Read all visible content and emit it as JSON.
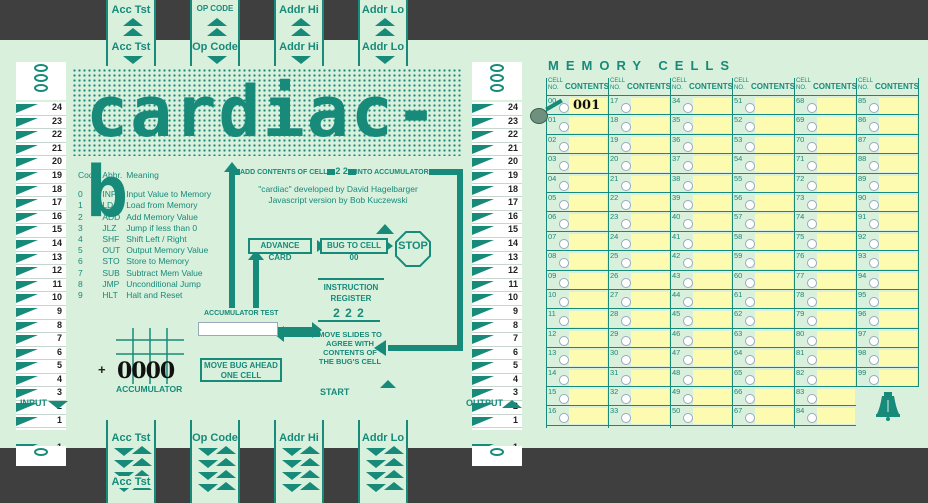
{
  "top_slides": [
    {
      "tab": "Acc Tst",
      "label": "Acc Tst"
    },
    {
      "tab": "OP CODE",
      "label": "Op Code"
    },
    {
      "tab": "Addr Hi",
      "label": "Addr Hi"
    },
    {
      "tab": "Addr Lo",
      "label": "Addr Lo"
    }
  ],
  "bottom_slides": [
    {
      "label": "Acc Tst",
      "tab": "Acc Tst"
    },
    {
      "label": "Op Code"
    },
    {
      "label": "Addr Hi"
    },
    {
      "label": "Addr Lo"
    }
  ],
  "title": "cardiac-b",
  "credits": [
    "\"cardiac\" developed by David Hagelbarger",
    "Javascript version by Bob Kuczewski"
  ],
  "codes": {
    "header": [
      "Code",
      "Abbr.",
      "Meaning"
    ],
    "rows": [
      [
        "0",
        "INP",
        "Input Value to Memory"
      ],
      [
        "1",
        "LD",
        "Load from Memory"
      ],
      [
        "2",
        "ADD",
        "Add Memory Value"
      ],
      [
        "3",
        "JLZ",
        "Jump if less than 0"
      ],
      [
        "4",
        "SHF",
        "Shift Left / Right"
      ],
      [
        "5",
        "OUT",
        "Output Memory Value"
      ],
      [
        "6",
        "STO",
        "Store to Memory"
      ],
      [
        "7",
        "SUB",
        "Subtract Mem Value"
      ],
      [
        "8",
        "JMP",
        "Unconditional Jump"
      ],
      [
        "9",
        "HLT",
        "Halt and Reset"
      ]
    ]
  },
  "add_contents": {
    "left": "ADD CONTENTS OF CELL",
    "value": "2 2",
    "right": "INTO ACCUMULATOR"
  },
  "advance_card": "ADVANCE CARD",
  "bug_to_cell": "BUG TO CELL 00",
  "stop": "STOP",
  "instruction_register": {
    "label": "INSTRUCTION REGISTER",
    "value": "2 2 2"
  },
  "move_slides": "MOVE SLIDES TO AGREE WITH CONTENTS OF THE BUG'S CELL",
  "start": "START",
  "accumulator_test": "ACCUMULATOR TEST",
  "move_bug": "MOVE BUG AHEAD ONE CELL",
  "accumulator": {
    "sign": "+",
    "value": "0000",
    "label": "ACCUMULATOR"
  },
  "input_label": "INPUT",
  "output_label": "OUTPUT",
  "left_strip_numbers": [
    "24",
    "23",
    "22",
    "21",
    "20",
    "19",
    "18",
    "17",
    "16",
    "15",
    "14",
    "13",
    "12",
    "11",
    "10",
    "9",
    "8",
    "7",
    "6",
    "5",
    "4",
    "3",
    "2",
    "1"
  ],
  "right_strip_numbers": [
    "24",
    "23",
    "22",
    "21",
    "20",
    "19",
    "18",
    "17",
    "16",
    "15",
    "14",
    "13",
    "12",
    "11",
    "10",
    "9",
    "8",
    "7",
    "6",
    "5",
    "4",
    "3",
    "2",
    "1"
  ],
  "input_value": "1",
  "output_value": "1",
  "memory": {
    "title": "MEMORY CELLS",
    "header_no": "CELL NO.",
    "header_contents": "CONTENTS",
    "columns": [
      [
        "00",
        "01",
        "02",
        "03",
        "04",
        "05",
        "06",
        "07",
        "08",
        "09",
        "10",
        "11",
        "12",
        "13",
        "14",
        "15",
        "16"
      ],
      [
        "17",
        "18",
        "19",
        "20",
        "21",
        "22",
        "23",
        "24",
        "25",
        "26",
        "27",
        "28",
        "29",
        "30",
        "31",
        "32",
        "33"
      ],
      [
        "34",
        "35",
        "36",
        "37",
        "38",
        "39",
        "40",
        "41",
        "42",
        "43",
        "44",
        "45",
        "46",
        "47",
        "48",
        "49",
        "50"
      ],
      [
        "51",
        "52",
        "53",
        "54",
        "55",
        "56",
        "57",
        "58",
        "59",
        "60",
        "61",
        "62",
        "63",
        "64",
        "65",
        "66",
        "67"
      ],
      [
        "68",
        "69",
        "70",
        "71",
        "72",
        "73",
        "74",
        "75",
        "76",
        "77",
        "78",
        "79",
        "80",
        "81",
        "82",
        "83",
        "84"
      ],
      [
        "85",
        "86",
        "87",
        "88",
        "89",
        "90",
        "91",
        "92",
        "93",
        "94",
        "95",
        "96",
        "97",
        "98",
        "99"
      ]
    ],
    "cell_00_contents": "001"
  },
  "colors": {
    "accent": "#178a7a",
    "board": "#d9f0dd",
    "cell_fill": "#fdfbb0",
    "background": "#3f3f3f"
  }
}
